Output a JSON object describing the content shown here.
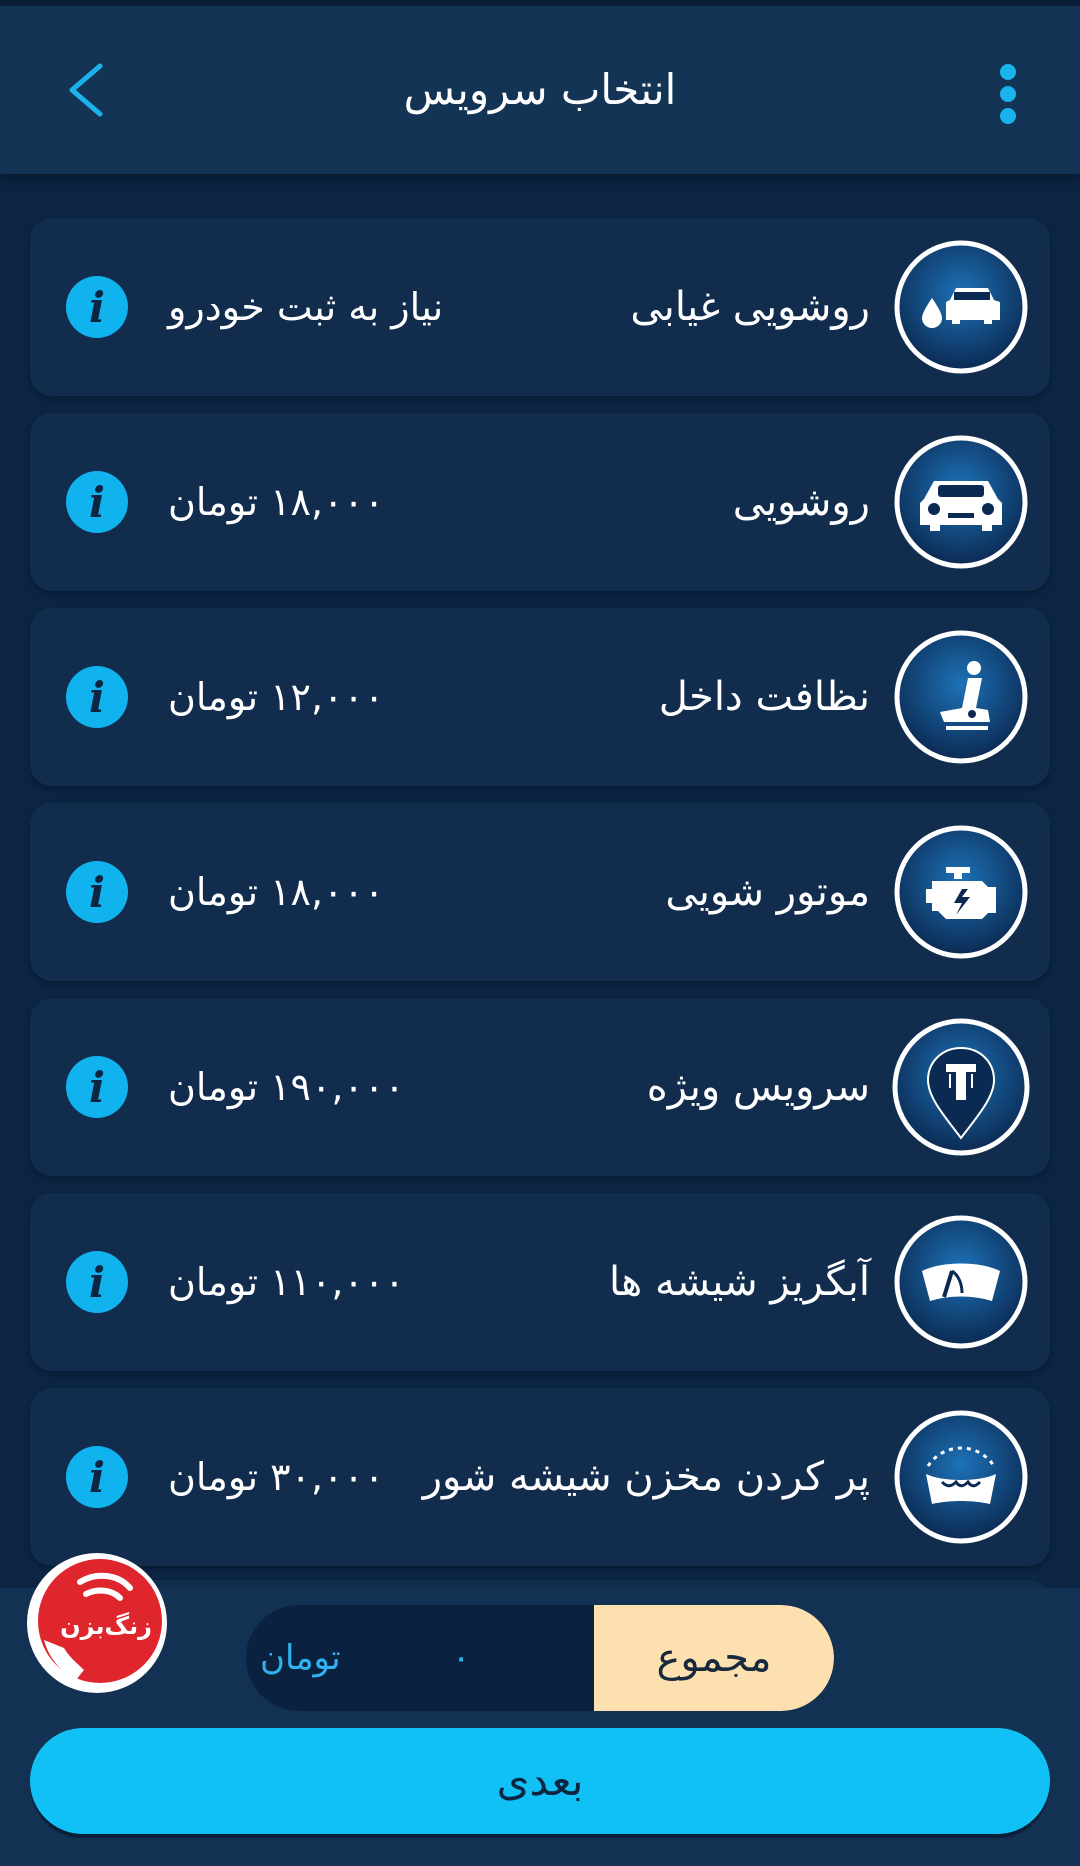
{
  "header": {
    "title": "انتخاب سرویس"
  },
  "services": [
    {
      "name": "روشویی غیابی",
      "price": "نیاز به ثبت خودرو",
      "icon": "car-drop-icon"
    },
    {
      "name": "روشویی",
      "price": "۱۸,۰۰۰ تومان",
      "icon": "car-front-icon"
    },
    {
      "name": "نظافت داخل",
      "price": "۱۲,۰۰۰ تومان",
      "icon": "car-seat-icon"
    },
    {
      "name": "موتور شویی",
      "price": "۱۸,۰۰۰ تومان",
      "icon": "engine-icon"
    },
    {
      "name": "سرویس ویژه",
      "price": "۱۹۰,۰۰۰ تومان",
      "icon": "brand-pin-icon"
    },
    {
      "name": "آبگریز شیشه ها",
      "price": "۱۱۰,۰۰۰ تومان",
      "icon": "windshield-icon"
    },
    {
      "name": "پر کردن مخزن شیشه شور",
      "price": "۳۰,۰۰۰ تومان",
      "icon": "washer-tank-icon"
    }
  ],
  "total": {
    "label": "مجموع",
    "value": "۰",
    "unit": "تومان"
  },
  "next_button": "بعدی",
  "call_button": "زنگ‌بزن",
  "colors": {
    "background": "#0b2543",
    "card": "#112c4d",
    "accent": "#11c1f5",
    "total_label_bg": "#fde0b0",
    "call_red": "#e0262d"
  }
}
